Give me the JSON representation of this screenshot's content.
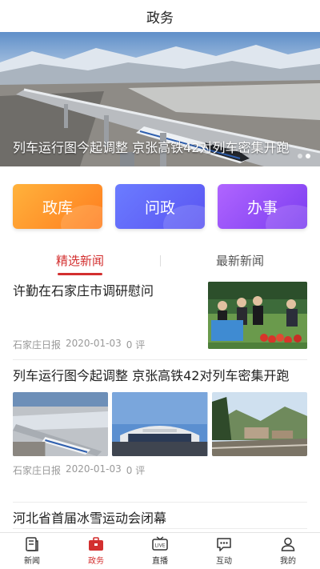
{
  "header": {
    "title": "政务"
  },
  "banner": {
    "caption": "列车运行图今起调整 京张高铁42对列车密集开跑",
    "dots": 2,
    "active_dot": 1
  },
  "actions": [
    {
      "label": "政库"
    },
    {
      "label": "问政"
    },
    {
      "label": "办事"
    }
  ],
  "tabs": [
    {
      "label": "精选新闻",
      "active": true
    },
    {
      "label": "最新新闻",
      "active": false
    }
  ],
  "news": [
    {
      "headline": "许勤在石家庄市调研慰问",
      "source": "石家庄日报",
      "date": "2020-01-03",
      "comments": "0 评"
    },
    {
      "headline": "列车运行图今起调整 京张高铁42对列车密集开跑",
      "source": "石家庄日报",
      "date": "2020-01-03",
      "comments": "0 评"
    },
    {
      "headline": "河北省首届冰雪运动会闭幕"
    }
  ],
  "bottom_nav": [
    {
      "label": "新闻",
      "icon": "news-icon"
    },
    {
      "label": "政务",
      "icon": "briefcase-icon",
      "active": true
    },
    {
      "label": "直播",
      "icon": "live-tv-icon"
    },
    {
      "label": "互动",
      "icon": "chat-icon"
    },
    {
      "label": "我的",
      "icon": "user-icon"
    }
  ],
  "colors": {
    "accent": "#d32f2f",
    "action_orange": "#ff8c2a",
    "action_blue": "#5f63f6",
    "action_purple": "#8f4bf5"
  }
}
